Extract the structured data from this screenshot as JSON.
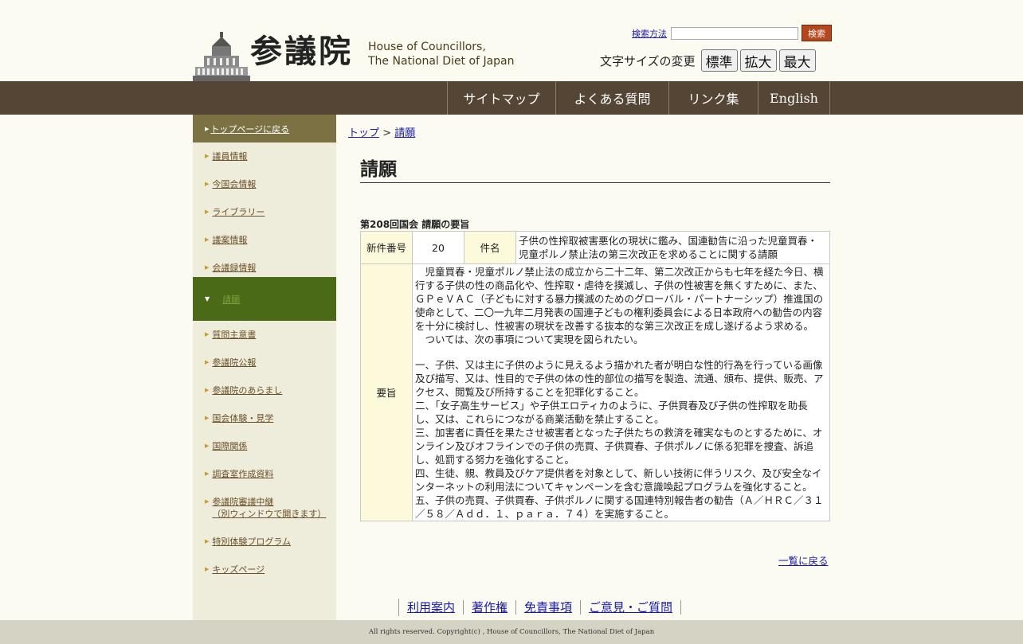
{
  "header": {
    "logo_kanji": "参議院",
    "logo_en_line1": "House of Councillors,",
    "logo_en_line2": "The National Diet of Japan",
    "search_help": "検索方法",
    "search_placeholder": "",
    "search_button": "検索",
    "fontsize_label": "文字サイズの変更",
    "fontsize_standard": "標準",
    "fontsize_large": "拡大",
    "fontsize_max": "最大"
  },
  "topnav": [
    "サイトマップ",
    "よくある質問",
    "リンク集",
    "English"
  ],
  "sidebar": {
    "top": "トップページに戻る",
    "items": [
      "議員情報",
      "今国会情報",
      "ライブラリー",
      "議案情報",
      "会議録情報"
    ],
    "active": "請願",
    "items2": [
      "質問主意書",
      "参議院公報",
      "参議院のあらまし",
      "国会体験・見学",
      "国際関係",
      "調査室作成資料"
    ],
    "relay_line1": "参議院審議中継",
    "relay_line2": "（別ウィンドウで開きます）",
    "items3": [
      "特別体験プログラム",
      "キッズページ"
    ]
  },
  "breadcrumb": {
    "home": "トップ",
    "sep": ">",
    "current": "請願"
  },
  "page_title": "請願",
  "subtitle": "第208回国会 請願の要旨",
  "petition": {
    "label_number": "新件番号",
    "number": "20",
    "label_subject": "件名",
    "subject": "子供の性搾取被害悪化の現状に鑑み、国連勧告に沿った児童買春・児童ポルノ禁止法の第三次改正を求めることに関する請願",
    "label_summary": "要旨",
    "para1": "　児童買春・児童ポルノ禁止法の成立から二十二年、第二次改正からも七年を経た今日、横行する子供の性の商品化や、性搾取・虐待を撲滅し、子供の性被害を無くすために、また、ＧＰｅＶＡＣ（子どもに対する暴力撲滅のためのグローバル・パートナーシップ）推進国の使命として、二〇一九年二月発表の国連子どもの権利委員会による日本政府への勧告の内容を十分に検討し、性被害の現状を改善する抜本的な第三次改正を成し遂げるよう求める。",
    "para2": "　ついては、次の事項について実現を図られたい。",
    "item1": "一、子供、又は主に子供のように見えるよう描かれた者が明白な性的行為を行っている画像及び描写、又は、性目的で子供の体の性的部位の描写を製造、流通、頒布、提供、販売、アクセス、閲覧及び所持することを犯罪化すること。",
    "item2": "二、「女子高生サービス」や子供エロティカのように、子供買春及び子供の性搾取を助長し、又は、これらにつながる商業活動を禁止すること。",
    "item3": "三、加害者に責任を果たさせ被害者となった子供たちの救済を確実なものとするために、オンライン及びオフラインでの子供の売買、子供買春、子供ポルノに係る犯罪を捜査、訴追し、処罰する努力を強化すること。",
    "item4": "四、生徒、親、教員及びケア提供者を対象として、新しい技術に伴うリスク、及び安全なインターネットの利用法についてキャンペーンを含む意識喚起プログラムを強化すること。",
    "item5": "五、子供の売買、子供買春、子供ポルノに関する国連特別報告者の勧告（Ａ／ＨＲＣ／３１／５８／Ａｄｄ．１、ｐａｒａ．７４）を実施すること。"
  },
  "back_link": "一覧に戻る",
  "footer": {
    "links": [
      "利用案内",
      "著作権",
      "免責事項",
      "ご意見・ご質問"
    ],
    "copyright": "All rights reserved. Copyright(c) , House of Councillors, The National Diet of Japan"
  }
}
